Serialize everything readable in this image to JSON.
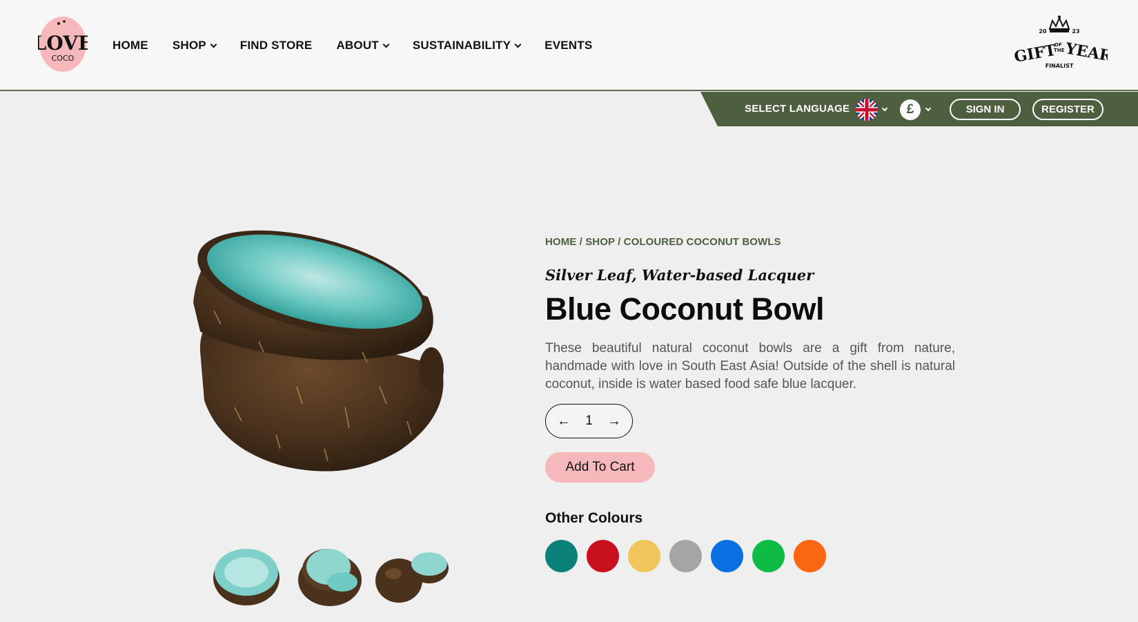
{
  "brand": {
    "logo_text": "LOVE",
    "logo_subtext": "COCO"
  },
  "nav": [
    {
      "label": "HOME",
      "dropdown": false
    },
    {
      "label": "SHOP",
      "dropdown": true
    },
    {
      "label": "FIND STORE",
      "dropdown": false
    },
    {
      "label": "ABOUT",
      "dropdown": true
    },
    {
      "label": "SUSTAINABILITY",
      "dropdown": true
    },
    {
      "label": "EVENTS",
      "dropdown": false
    }
  ],
  "award": {
    "year_left": "20",
    "year_right": "23",
    "main": "GIFT",
    "of_the": "OF THE",
    "year_word": "YEAR",
    "status": "FINALIST"
  },
  "utility": {
    "language_label": "SELECT LANGUAGE",
    "currency_symbol": "£",
    "sign_in": "SIGN IN",
    "register": "REGISTER"
  },
  "product": {
    "breadcrumb": "HOME / SHOP / COLOURED COCONUT BOWLS",
    "subtitle": "Silver Leaf, Water-based Lacquer",
    "title": "Blue Coconut Bowl",
    "description": "These beautiful natural coconut bowls are a gift from nature, handmade with love in South East Asia! Outside of the shell is natural coconut, inside is water based food safe blue lacquer.",
    "quantity": "1",
    "add_to_cart": "Add To Cart",
    "other_colours_title": "Other Colours",
    "colours": [
      "#0b8079",
      "#c8101e",
      "#f0c65c",
      "#a5a5a5",
      "#0a6fe0",
      "#0fba45",
      "#fb6611"
    ]
  },
  "colors": {
    "accent_green": "#4d5f3f",
    "cart_pink": "#f6b8bb",
    "lacquer": "#5fc7c1"
  }
}
